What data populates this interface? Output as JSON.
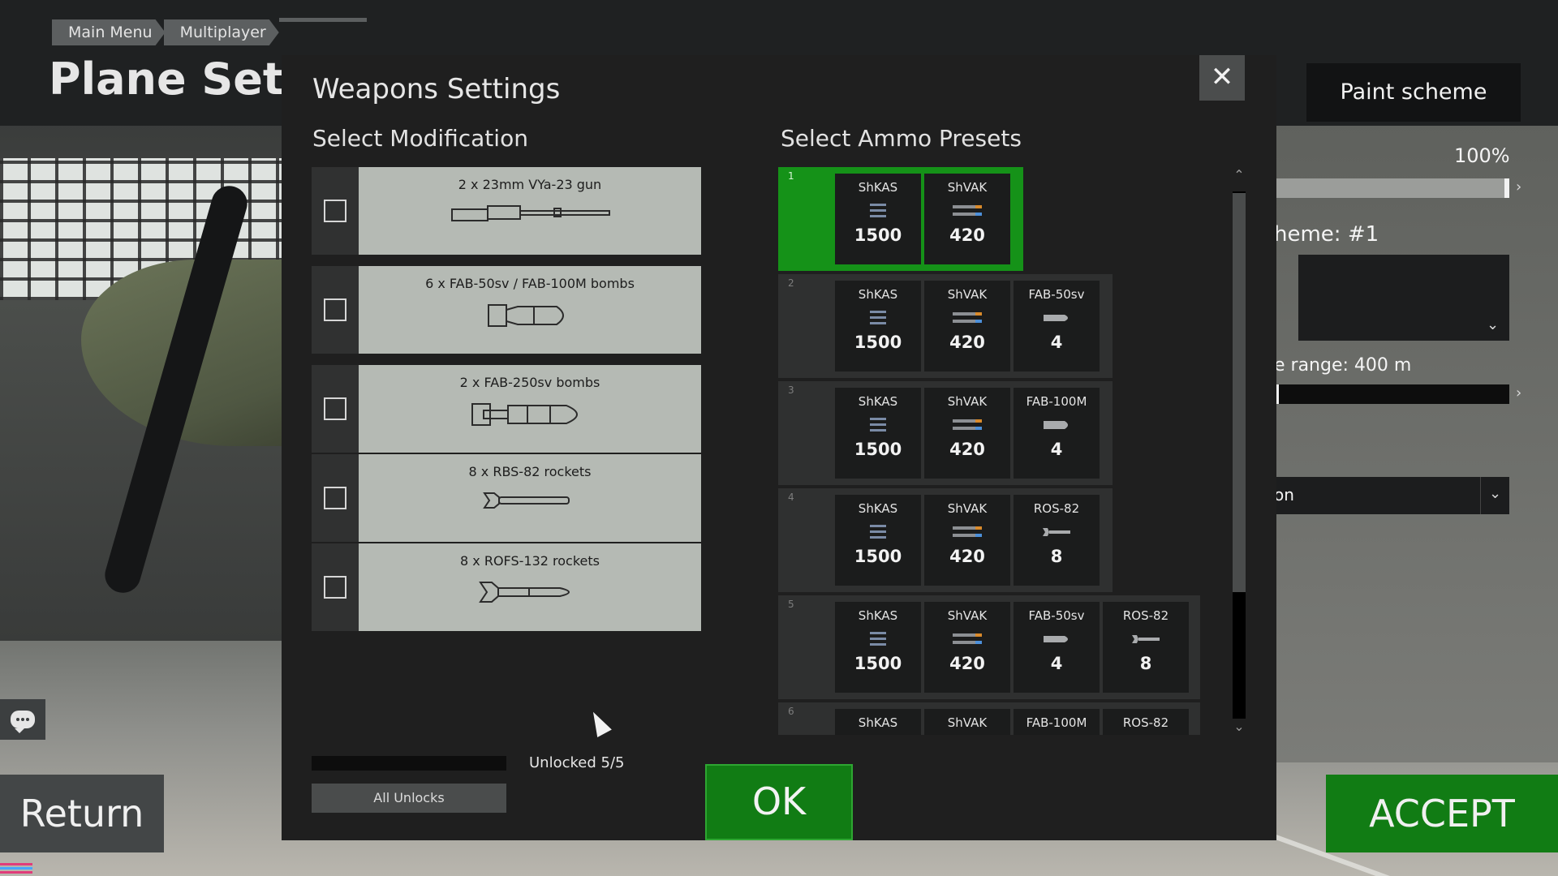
{
  "colors": {
    "accent_green": "#117c14",
    "preset_selected": "#159218",
    "modal_bg": "#1f1f1f",
    "card_bg": "#b5bab4"
  },
  "breadcrumb": [
    "Main Menu",
    "Multiplayer"
  ],
  "page_title": "Plane Settir",
  "right_panel": {
    "tab_label": "Paint scheme",
    "percent": "100%",
    "scheme_label": "heme: #1",
    "range_label": "e range: 400 m",
    "dropdown_value": "on"
  },
  "buttons": {
    "return": "Return",
    "accept": "ACCEPT",
    "ok": "OK",
    "close": "✕",
    "all_unlocks": "All Unlocks"
  },
  "modal": {
    "title": "Weapons Settings",
    "select_modification": "Select Modification",
    "select_ammo_presets": "Select Ammo Presets",
    "unlocked_text": "Unlocked 5/5",
    "modifications": [
      {
        "name": "2 x 23mm VYa-23 gun",
        "icon": "gun-icon",
        "checked": false
      },
      {
        "name": "6 x FAB-50sv / FAB-100M bombs",
        "icon": "bomb-icon",
        "checked": false
      },
      {
        "name": "2 x FAB-250sv bombs",
        "icon": "large-bomb-icon",
        "checked": false
      },
      {
        "name": "8 x RBS-82 rockets",
        "icon": "rocket-icon",
        "checked": false
      },
      {
        "name": "8 x ROFS-132 rockets",
        "icon": "large-rocket-icon",
        "checked": false
      }
    ],
    "presets": [
      {
        "number": "1",
        "selected": true,
        "ammo": [
          {
            "name": "ShKAS",
            "count": "1500",
            "icon": "bullets-icon"
          },
          {
            "name": "ShVAK",
            "count": "420",
            "icon": "shells-icon"
          }
        ]
      },
      {
        "number": "2",
        "selected": false,
        "ammo": [
          {
            "name": "ShKAS",
            "count": "1500",
            "icon": "bullets-icon"
          },
          {
            "name": "ShVAK",
            "count": "420",
            "icon": "shells-icon"
          },
          {
            "name": "FAB-50sv",
            "count": "4",
            "icon": "bomb-icon"
          }
        ]
      },
      {
        "number": "3",
        "selected": false,
        "ammo": [
          {
            "name": "ShKAS",
            "count": "1500",
            "icon": "bullets-icon"
          },
          {
            "name": "ShVAK",
            "count": "420",
            "icon": "shells-icon"
          },
          {
            "name": "FAB-100M",
            "count": "4",
            "icon": "bomb-icon"
          }
        ]
      },
      {
        "number": "4",
        "selected": false,
        "ammo": [
          {
            "name": "ShKAS",
            "count": "1500",
            "icon": "bullets-icon"
          },
          {
            "name": "ShVAK",
            "count": "420",
            "icon": "shells-icon"
          },
          {
            "name": "ROS-82",
            "count": "8",
            "icon": "rocket-icon"
          }
        ]
      },
      {
        "number": "5",
        "selected": false,
        "ammo": [
          {
            "name": "ShKAS",
            "count": "1500",
            "icon": "bullets-icon"
          },
          {
            "name": "ShVAK",
            "count": "420",
            "icon": "shells-icon"
          },
          {
            "name": "FAB-50sv",
            "count": "4",
            "icon": "bomb-icon"
          },
          {
            "name": "ROS-82",
            "count": "8",
            "icon": "rocket-icon"
          }
        ]
      },
      {
        "number": "6",
        "selected": false,
        "ammo": [
          {
            "name": "ShKAS",
            "count": "",
            "icon": "bullets-icon"
          },
          {
            "name": "ShVAK",
            "count": "",
            "icon": "shells-icon"
          },
          {
            "name": "FAB-100M",
            "count": "",
            "icon": "bomb-icon"
          },
          {
            "name": "ROS-82",
            "count": "",
            "icon": "rocket-icon"
          }
        ]
      }
    ],
    "scroll_position": 0.0
  }
}
